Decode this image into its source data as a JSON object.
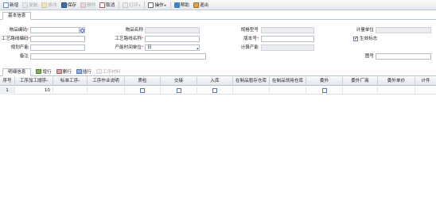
{
  "toolbar": {
    "new": "新增",
    "copy": "复制",
    "edit": "修改",
    "save": "保存",
    "delete": "删除",
    "cancel": "取消",
    "print": "打印",
    "operate": "操作",
    "help": "帮助",
    "exit": "退出"
  },
  "tabs": {
    "basic": "基本信息",
    "detail": "明细信息"
  },
  "form": {
    "item_code": {
      "label": "物品编码",
      "value": ""
    },
    "item_name": {
      "label": "物品名称",
      "value": ""
    },
    "spec": {
      "label": "规格型号",
      "value": ""
    },
    "unit": {
      "label": "计量单位",
      "value": ""
    },
    "route_code": {
      "label": "工艺路线编码",
      "value": ""
    },
    "route_name": {
      "label": "工艺路线名称",
      "value": ""
    },
    "version": {
      "label": "版本号",
      "value": ""
    },
    "effective": {
      "label": "生效标志",
      "checked": true
    },
    "planned_output": {
      "label": "规划产能",
      "value": ""
    },
    "cycle_unit": {
      "label": "产能时间单位",
      "value": "日"
    },
    "calc_output": {
      "label": "计算产能",
      "value": ""
    },
    "remark": {
      "label": "备注",
      "value": ""
    },
    "drawing_no": {
      "label": "图号",
      "value": ""
    }
  },
  "detail_toolbar": {
    "add_row": "增行",
    "delete_row": "删行",
    "insert_row": "插行",
    "process_material": "工序材料"
  },
  "grid": {
    "columns": [
      "序号",
      "工序加工顺序",
      "标准工序",
      "工序作业说明",
      "质检",
      "交接",
      "入库",
      "在制品暂存仓库",
      "在制品领用仓库",
      "委外",
      "委外厂商",
      "委外单价",
      "计件"
    ],
    "rows": [
      {
        "no": "1",
        "seq": "10",
        "std": "",
        "desc": "",
        "qc": false,
        "handover": false,
        "stockin": false,
        "wip_store": "",
        "wip_issue": "",
        "outsource": false,
        "vendor": "",
        "price": ""
      }
    ]
  }
}
